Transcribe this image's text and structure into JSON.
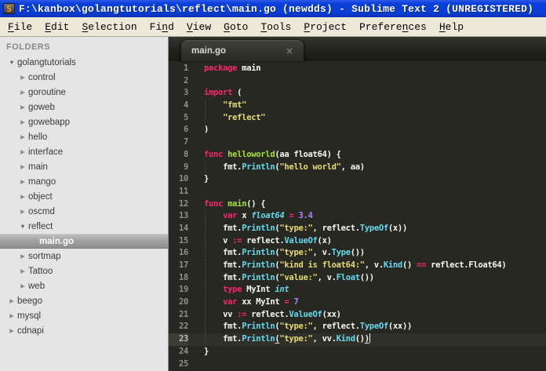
{
  "window": {
    "title": "F:\\kanbox\\golangtutorials\\reflect\\main.go (newdds) - Sublime Text 2 (UNREGISTERED)",
    "app_icon_letter": "S"
  },
  "colors": {
    "titlebar_blue": "#0a3ed8",
    "menubar_bg": "#ece9d8",
    "sidebar_bg": "#e5e5e5",
    "editor_bg": "#272822",
    "keyword_pink": "#f92672",
    "string_yellow": "#e6db74",
    "function_green": "#a6e22e",
    "type_cyan": "#66d9ef",
    "number_purple": "#ae81ff",
    "plain_text": "#f8f8f2"
  },
  "menu": {
    "items": [
      {
        "label": "File",
        "mnemonic_index": 0
      },
      {
        "label": "Edit",
        "mnemonic_index": 0
      },
      {
        "label": "Selection",
        "mnemonic_index": 0
      },
      {
        "label": "Find",
        "mnemonic_index": 2
      },
      {
        "label": "View",
        "mnemonic_index": 0
      },
      {
        "label": "Goto",
        "mnemonic_index": 0
      },
      {
        "label": "Tools",
        "mnemonic_index": 0
      },
      {
        "label": "Project",
        "mnemonic_index": 0
      },
      {
        "label": "Preferences",
        "mnemonic_index": 7
      },
      {
        "label": "Help",
        "mnemonic_index": 0
      }
    ]
  },
  "sidebar": {
    "header": "FOLDERS",
    "items": [
      {
        "label": "golangtutorials",
        "level": 0,
        "kind": "folder",
        "state": "expanded"
      },
      {
        "label": "control",
        "level": 1,
        "kind": "folder",
        "state": "collapsed"
      },
      {
        "label": "goroutine",
        "level": 1,
        "kind": "folder",
        "state": "collapsed"
      },
      {
        "label": "goweb",
        "level": 1,
        "kind": "folder",
        "state": "collapsed"
      },
      {
        "label": "gowebapp",
        "level": 1,
        "kind": "folder",
        "state": "collapsed"
      },
      {
        "label": "hello",
        "level": 1,
        "kind": "folder",
        "state": "collapsed"
      },
      {
        "label": "interface",
        "level": 1,
        "kind": "folder",
        "state": "collapsed"
      },
      {
        "label": "main",
        "level": 1,
        "kind": "folder",
        "state": "collapsed"
      },
      {
        "label": "mango",
        "level": 1,
        "kind": "folder",
        "state": "collapsed"
      },
      {
        "label": "object",
        "level": 1,
        "kind": "folder",
        "state": "collapsed"
      },
      {
        "label": "oscmd",
        "level": 1,
        "kind": "folder",
        "state": "collapsed"
      },
      {
        "label": "reflect",
        "level": 1,
        "kind": "folder",
        "state": "expanded"
      },
      {
        "label": "main.go",
        "level": 2,
        "kind": "file",
        "selected": true
      },
      {
        "label": "sortmap",
        "level": 1,
        "kind": "folder",
        "state": "collapsed"
      },
      {
        "label": "Tattoo",
        "level": 1,
        "kind": "folder",
        "state": "collapsed"
      },
      {
        "label": "web",
        "level": 1,
        "kind": "folder",
        "state": "collapsed"
      },
      {
        "label": "beego",
        "level": 0,
        "kind": "folder",
        "state": "collapsed"
      },
      {
        "label": "mysql",
        "level": 0,
        "kind": "folder",
        "state": "collapsed"
      },
      {
        "label": "cdnapi",
        "level": 0,
        "kind": "folder",
        "state": "collapsed"
      }
    ]
  },
  "editor": {
    "tab": {
      "label": "main.go",
      "close_glyph": "×"
    },
    "code": {
      "active_line": 23,
      "lines": [
        {
          "n": 1,
          "tokens": [
            [
              "kw",
              "package"
            ],
            [
              "pl",
              " main"
            ]
          ]
        },
        {
          "n": 2,
          "tokens": []
        },
        {
          "n": 3,
          "tokens": [
            [
              "kw",
              "import"
            ],
            [
              "pl",
              " ("
            ]
          ]
        },
        {
          "n": 4,
          "guide": true,
          "tokens": [
            [
              "pl",
              "    "
            ],
            [
              "str",
              "\"fmt\""
            ]
          ]
        },
        {
          "n": 5,
          "guide": true,
          "tokens": [
            [
              "pl",
              "    "
            ],
            [
              "str",
              "\"reflect\""
            ]
          ]
        },
        {
          "n": 6,
          "tokens": [
            [
              "pl",
              ")"
            ]
          ]
        },
        {
          "n": 7,
          "tokens": []
        },
        {
          "n": 8,
          "tokens": [
            [
              "kw",
              "func"
            ],
            [
              "pl",
              " "
            ],
            [
              "fn",
              "helloworld"
            ],
            [
              "pl",
              "(aa float64) {"
            ]
          ]
        },
        {
          "n": 9,
          "guide": true,
          "tokens": [
            [
              "pl",
              "    fmt."
            ],
            [
              "call",
              "Println"
            ],
            [
              "pl",
              "("
            ],
            [
              "str",
              "\"hello world\""
            ],
            [
              "pl",
              ", aa)"
            ]
          ]
        },
        {
          "n": 10,
          "tokens": [
            [
              "pl",
              "}"
            ]
          ]
        },
        {
          "n": 11,
          "tokens": []
        },
        {
          "n": 12,
          "tokens": [
            [
              "kw",
              "func"
            ],
            [
              "pl",
              " "
            ],
            [
              "fn",
              "main"
            ],
            [
              "pl",
              "() {"
            ]
          ]
        },
        {
          "n": 13,
          "guide": true,
          "tokens": [
            [
              "pl",
              "    "
            ],
            [
              "kw",
              "var"
            ],
            [
              "pl",
              " x "
            ],
            [
              "typ",
              "float64"
            ],
            [
              "pl",
              " "
            ],
            [
              "kw",
              "="
            ],
            [
              "pl",
              " "
            ],
            [
              "num",
              "3.4"
            ]
          ]
        },
        {
          "n": 14,
          "guide": true,
          "tokens": [
            [
              "pl",
              "    fmt."
            ],
            [
              "call",
              "Println"
            ],
            [
              "pl",
              "("
            ],
            [
              "str",
              "\"type:\""
            ],
            [
              "pl",
              ", reflect."
            ],
            [
              "call",
              "TypeOf"
            ],
            [
              "pl",
              "(x))"
            ]
          ]
        },
        {
          "n": 15,
          "guide": true,
          "tokens": [
            [
              "pl",
              "    v "
            ],
            [
              "kw",
              ":="
            ],
            [
              "pl",
              " reflect."
            ],
            [
              "call",
              "ValueOf"
            ],
            [
              "pl",
              "(x)"
            ]
          ]
        },
        {
          "n": 16,
          "guide": true,
          "tokens": [
            [
              "pl",
              "    fmt."
            ],
            [
              "call",
              "Println"
            ],
            [
              "pl",
              "("
            ],
            [
              "str",
              "\"type:\""
            ],
            [
              "pl",
              ", v."
            ],
            [
              "call",
              "Type"
            ],
            [
              "pl",
              "())"
            ]
          ]
        },
        {
          "n": 17,
          "guide": true,
          "tokens": [
            [
              "pl",
              "    fmt."
            ],
            [
              "call",
              "Println"
            ],
            [
              "pl",
              "("
            ],
            [
              "str",
              "\"kind is float64:\""
            ],
            [
              "pl",
              ", v."
            ],
            [
              "call",
              "Kind"
            ],
            [
              "pl",
              "() "
            ],
            [
              "kw",
              "=="
            ],
            [
              "pl",
              " reflect.Float64)"
            ]
          ]
        },
        {
          "n": 18,
          "guide": true,
          "tokens": [
            [
              "pl",
              "    fmt."
            ],
            [
              "call",
              "Println"
            ],
            [
              "pl",
              "("
            ],
            [
              "str",
              "\"value:\""
            ],
            [
              "pl",
              ", v."
            ],
            [
              "call",
              "Float"
            ],
            [
              "pl",
              "())"
            ]
          ]
        },
        {
          "n": 19,
          "guide": true,
          "tokens": [
            [
              "pl",
              "    "
            ],
            [
              "kw",
              "type"
            ],
            [
              "pl",
              " MyInt "
            ],
            [
              "typ",
              "int"
            ]
          ]
        },
        {
          "n": 20,
          "guide": true,
          "tokens": [
            [
              "pl",
              "    "
            ],
            [
              "kw",
              "var"
            ],
            [
              "pl",
              " xx MyInt "
            ],
            [
              "kw",
              "="
            ],
            [
              "pl",
              " "
            ],
            [
              "num",
              "7"
            ]
          ]
        },
        {
          "n": 21,
          "guide": true,
          "tokens": [
            [
              "pl",
              "    vv "
            ],
            [
              "kw",
              ":="
            ],
            [
              "pl",
              " reflect."
            ],
            [
              "call",
              "ValueOf"
            ],
            [
              "pl",
              "(xx)"
            ]
          ]
        },
        {
          "n": 22,
          "guide": true,
          "tokens": [
            [
              "pl",
              "    fmt."
            ],
            [
              "call",
              "Println"
            ],
            [
              "pl",
              "("
            ],
            [
              "str",
              "\"type:\""
            ],
            [
              "pl",
              ", reflect."
            ],
            [
              "call",
              "TypeOf"
            ],
            [
              "pl",
              "(xx))"
            ]
          ]
        },
        {
          "n": 23,
          "guide": true,
          "tokens": [
            [
              "pl",
              "    fmt."
            ],
            [
              "call",
              "Println"
            ],
            [
              "pl",
              "(",
              "u"
            ],
            [
              "str",
              "\"type:\""
            ],
            [
              "pl",
              ", vv."
            ],
            [
              "call",
              "Kind"
            ],
            [
              "pl",
              "()"
            ],
            [
              "pl",
              ")",
              "u"
            ]
          ]
        },
        {
          "n": 24,
          "tokens": [
            [
              "pl",
              "}"
            ]
          ]
        },
        {
          "n": 25,
          "tokens": []
        }
      ]
    }
  }
}
